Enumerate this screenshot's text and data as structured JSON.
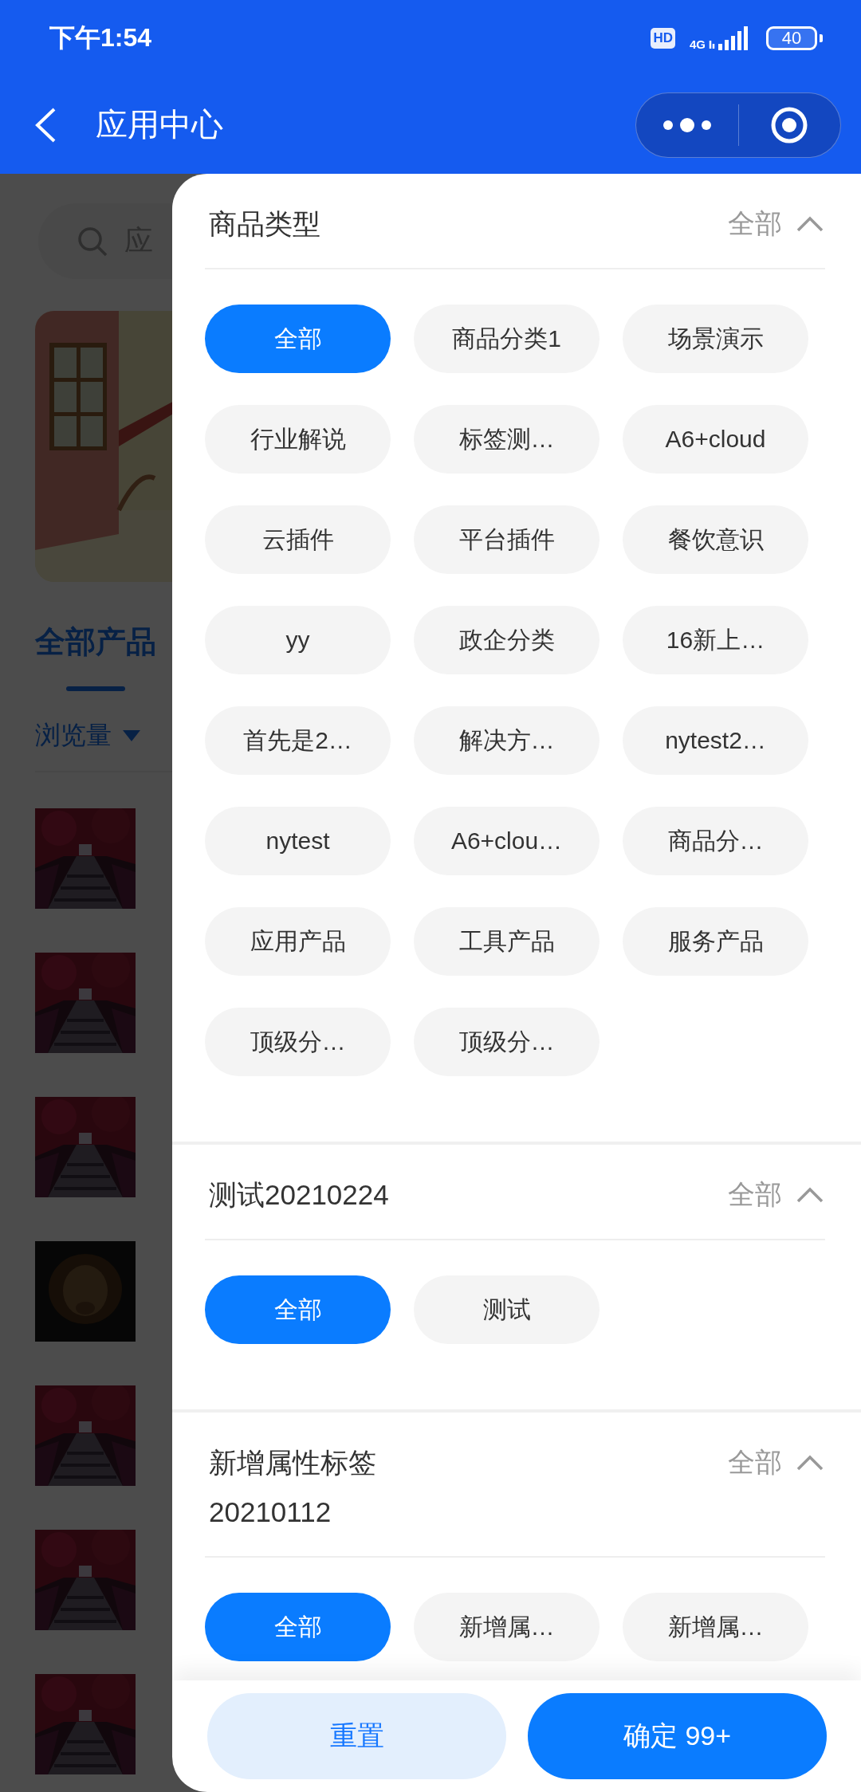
{
  "status_bar": {
    "time": "下午1:54",
    "hd": "HD",
    "network": "4G",
    "battery": "40"
  },
  "nav": {
    "title": "应用中心"
  },
  "page": {
    "search": {
      "placeholder": "应"
    },
    "tabs": [
      {
        "label": "全部产品",
        "selected": true
      }
    ],
    "sort": {
      "label": "浏览量"
    }
  },
  "filter": {
    "sections": [
      {
        "title": "商品类型",
        "all_label": "全部",
        "expanded": true,
        "options": [
          {
            "label": "全部",
            "selected": true
          },
          {
            "label": "商品分类1",
            "selected": false
          },
          {
            "label": "场景演示",
            "selected": false
          },
          {
            "label": "行业解说",
            "selected": false
          },
          {
            "label": "标签测…",
            "selected": false
          },
          {
            "label": "A6+cloud",
            "selected": false
          },
          {
            "label": "云插件",
            "selected": false
          },
          {
            "label": "平台插件",
            "selected": false
          },
          {
            "label": "餐饮意识",
            "selected": false
          },
          {
            "label": "yy",
            "selected": false
          },
          {
            "label": "政企分类",
            "selected": false
          },
          {
            "label": "16新上…",
            "selected": false
          },
          {
            "label": "首先是2…",
            "selected": false
          },
          {
            "label": "解决方…",
            "selected": false
          },
          {
            "label": "nytest2…",
            "selected": false
          },
          {
            "label": "nytest",
            "selected": false
          },
          {
            "label": "A6+clou…",
            "selected": false
          },
          {
            "label": "商品分…",
            "selected": false
          },
          {
            "label": "应用产品",
            "selected": false
          },
          {
            "label": "工具产品",
            "selected": false
          },
          {
            "label": "服务产品",
            "selected": false
          },
          {
            "label": "顶级分…",
            "selected": false
          },
          {
            "label": "顶级分…",
            "selected": false
          }
        ]
      },
      {
        "title": "测试20210224",
        "all_label": "全部",
        "expanded": true,
        "options": [
          {
            "label": "全部",
            "selected": true
          },
          {
            "label": "测试",
            "selected": false
          }
        ]
      },
      {
        "title": "新增属性标签20210112",
        "all_label": "全部",
        "expanded": true,
        "options": [
          {
            "label": "全部",
            "selected": true
          },
          {
            "label": "新增属…",
            "selected": false
          },
          {
            "label": "新增属…",
            "selected": false
          }
        ]
      }
    ],
    "reset_button": "重置",
    "confirm_button": "确定 99+"
  }
}
